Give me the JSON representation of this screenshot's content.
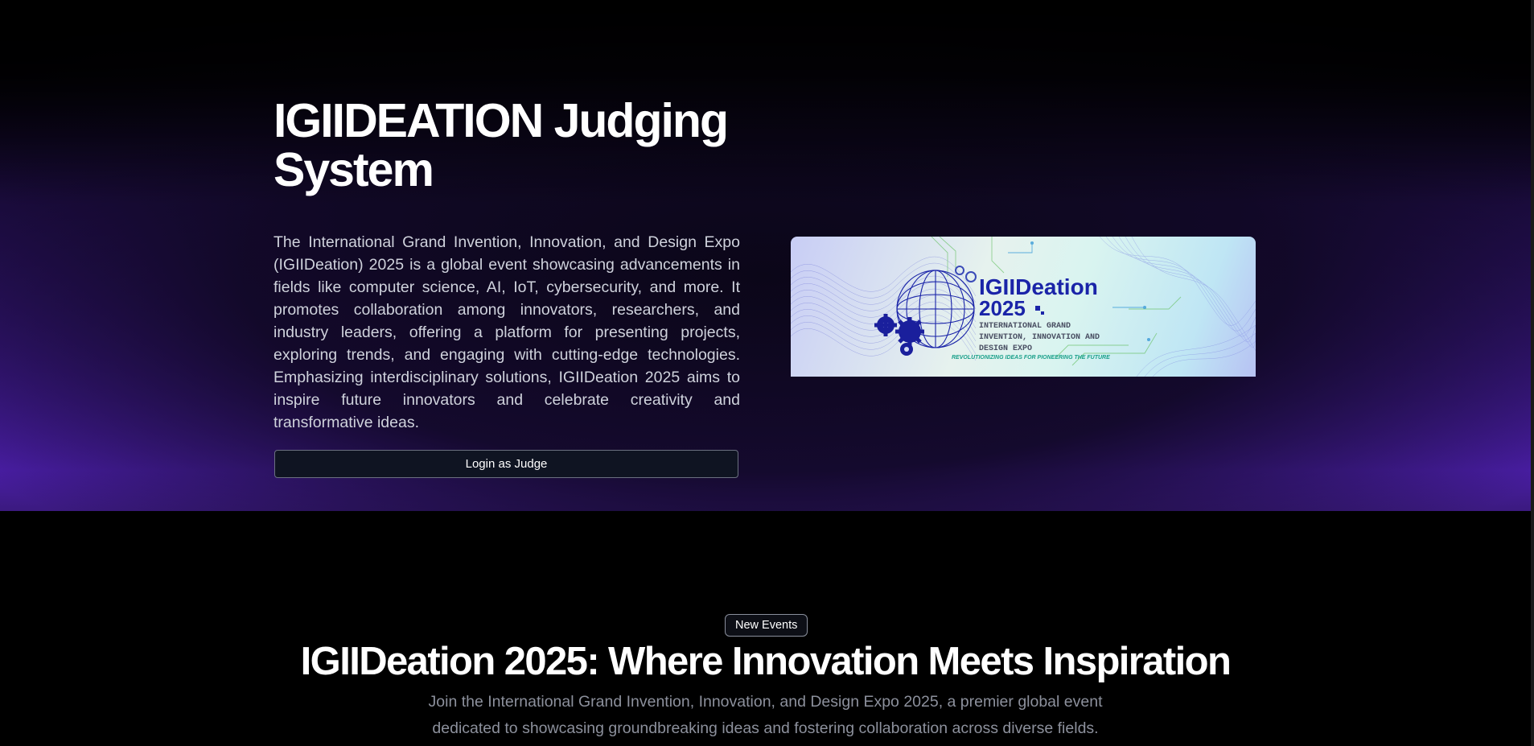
{
  "hero": {
    "title": "IGIIDEATION Judging System",
    "description": "The International Grand Invention, Innovation, and Design Expo (IGIIDeation) 2025 is a global event showcasing advancements in fields like computer science, AI, IoT, cybersecurity, and more. It promotes collaboration among innovators, researchers, and industry leaders, offering a platform for presenting projects, exploring trends, and engaging with cutting-edge technologies. Emphasizing interdisciplinary solutions, IGIIDeation 2025 aims to inspire future innovators and celebrate creativity and transformative ideas.",
    "login_button": "Login as Judge"
  },
  "banner": {
    "brand": "IGIIDeation",
    "year": "2025",
    "line1": "INTERNATIONAL GRAND",
    "line2": "INVENTION, INNOVATION AND",
    "line3": "DESIGN EXPO",
    "tagline": "REVOLUTIONIZING IDEAS FOR PIONEERING THE FUTURE",
    "colors": {
      "brand_blue": "#1a24a8",
      "text_gray": "#4a4f63",
      "tagline_teal": "#1aa08a"
    }
  },
  "events": {
    "badge": "New Events",
    "title": "IGIIDeation 2025: Where Innovation Meets Inspiration",
    "subtitle": "Join the International Grand Invention, Innovation, and Design Expo 2025, a premier global event dedicated to showcasing groundbreaking ideas and fostering collaboration across diverse fields."
  },
  "colors": {
    "page_background": "#000000",
    "hero_glow": "#4a1ea6",
    "button_background": "#0f1422"
  }
}
